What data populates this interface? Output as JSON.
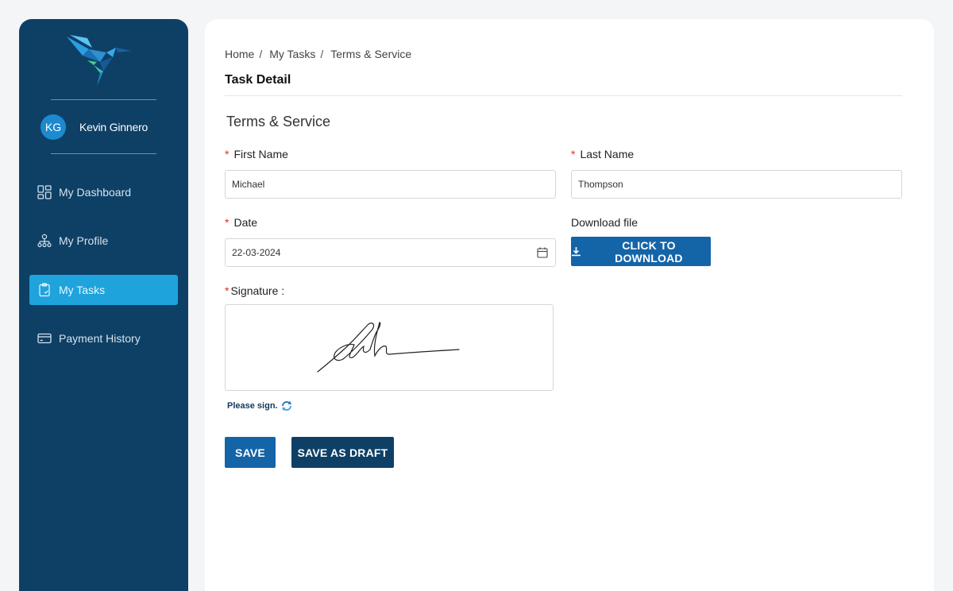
{
  "user": {
    "initials": "KG",
    "name": "Kevin Ginnero"
  },
  "nav": [
    {
      "label": "My Dashboard",
      "icon": "dashboard-icon"
    },
    {
      "label": "My Profile",
      "icon": "profile-icon"
    },
    {
      "label": "My Tasks",
      "icon": "tasks-icon",
      "active": true
    },
    {
      "label": "Payment History",
      "icon": "card-icon"
    }
  ],
  "breadcrumb": [
    "Home",
    "My Tasks",
    "Terms & Service"
  ],
  "breadcrumb_sep": "/",
  "page_title": "Task Detail",
  "section_title": "Terms & Service",
  "form": {
    "first_name_label": "First Name",
    "first_name_value": "Michael",
    "last_name_label": "Last Name",
    "last_name_value": "Thompson",
    "date_label": "Date",
    "date_value": "22-03-2024",
    "download_label": "Download file",
    "download_button": "CLICK TO DOWNLOAD",
    "signature_label": "Signature :",
    "please_sign": "Please sign.",
    "required_mark": "*"
  },
  "actions": {
    "save": "SAVE",
    "save_draft": "SAVE AS DRAFT"
  },
  "colors": {
    "sidebar": "#0e4066",
    "active_nav": "#1ea3dc",
    "primary": "#1464a8",
    "required": "#e0282e"
  }
}
